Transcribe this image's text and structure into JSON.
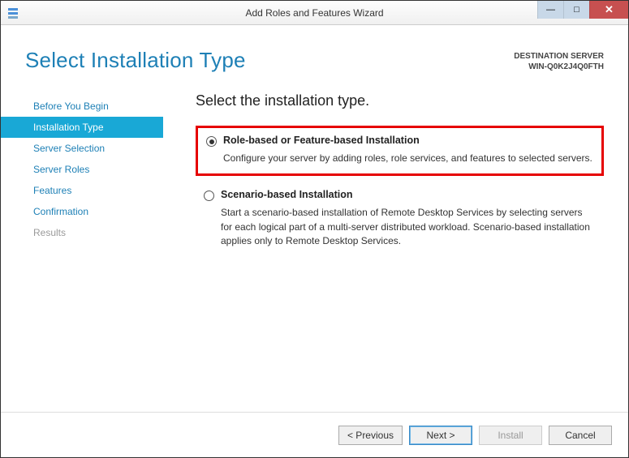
{
  "window": {
    "title": "Add Roles and Features Wizard"
  },
  "header": {
    "heading": "Select Installation Type",
    "destination_label": "DESTINATION SERVER",
    "destination_name": "WIN-Q0K2J4Q0FTH"
  },
  "sidebar": {
    "items": [
      {
        "label": "Before You Begin",
        "active": false,
        "dim": false
      },
      {
        "label": "Installation Type",
        "active": true,
        "dim": false
      },
      {
        "label": "Server Selection",
        "active": false,
        "dim": false
      },
      {
        "label": "Server Roles",
        "active": false,
        "dim": false
      },
      {
        "label": "Features",
        "active": false,
        "dim": false
      },
      {
        "label": "Confirmation",
        "active": false,
        "dim": false
      },
      {
        "label": "Results",
        "active": false,
        "dim": true
      }
    ]
  },
  "main": {
    "title": "Select the installation type.",
    "options": [
      {
        "title": "Role-based or Feature-based Installation",
        "desc": "Configure your server by adding roles, role services, and features to selected servers.",
        "selected": true,
        "highlighted": true
      },
      {
        "title": "Scenario-based Installation",
        "desc": "Start a scenario-based installation of Remote Desktop Services by selecting servers for each logical part of a multi-server distributed workload. Scenario-based installation applies only to Remote Desktop Services.",
        "selected": false,
        "highlighted": false
      }
    ]
  },
  "footer": {
    "previous": "< Previous",
    "next": "Next >",
    "install": "Install",
    "cancel": "Cancel"
  }
}
